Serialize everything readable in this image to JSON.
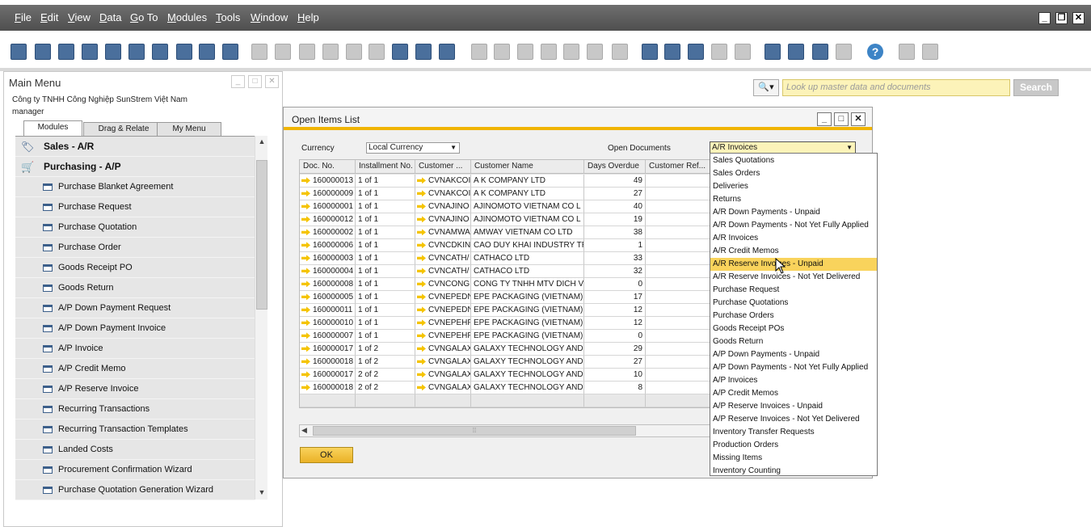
{
  "menubar": {
    "items": [
      "File",
      "Edit",
      "View",
      "Data",
      "Go To",
      "Modules",
      "Tools",
      "Window",
      "Help"
    ],
    "underline": [
      "F",
      "E",
      "V",
      "D",
      "G",
      "M",
      "T",
      "W",
      "H"
    ],
    "window_controls": [
      "_",
      "❐",
      "✕"
    ]
  },
  "toolbar": {
    "icons": [
      "print-preview-icon",
      "print-icon",
      "email-icon",
      "sms-icon",
      "fax-icon",
      "excel-icon",
      "word-icon",
      "pdf-icon",
      "move-icon",
      "lock-icon",
      "find-icon",
      "add-icon",
      "first-record-icon",
      "previous-record-icon",
      "next-record-icon",
      "last-record-icon",
      "refresh-icon",
      "filter-icon",
      "sort-icon",
      "base-document-icon",
      "target-document-icon",
      "gross-profit-icon",
      "payment-means-icon",
      "volume-weight-icon",
      "freight-icon",
      "journal-icon",
      "edit-form-icon",
      "new-document-icon",
      "settings-icon",
      "messages-icon",
      "alerts-icon",
      "activity-icon",
      "inbox-icon",
      "calendar-icon",
      "structure-icon",
      "help-icon",
      "customize-icon",
      "query-icon"
    ]
  },
  "main_menu": {
    "title": "Main Menu",
    "company": "Công ty TNHH Công Nghiệp SunStrem Việt Nam",
    "user": "manager",
    "tabs": [
      "Modules",
      "Drag & Relate",
      "My Menu"
    ],
    "items": [
      {
        "label": "Sales - A/R",
        "type": "module",
        "icon": "sales-icon"
      },
      {
        "label": "Purchasing - A/P",
        "type": "module",
        "icon": "cart-icon"
      },
      {
        "label": "Purchase Blanket Agreement",
        "type": "sub"
      },
      {
        "label": "Purchase Request",
        "type": "sub"
      },
      {
        "label": "Purchase Quotation",
        "type": "sub"
      },
      {
        "label": "Purchase Order",
        "type": "sub"
      },
      {
        "label": "Goods Receipt PO",
        "type": "sub"
      },
      {
        "label": "Goods Return",
        "type": "sub"
      },
      {
        "label": "A/P Down Payment Request",
        "type": "sub"
      },
      {
        "label": "A/P Down Payment Invoice",
        "type": "sub"
      },
      {
        "label": "A/P Invoice",
        "type": "sub"
      },
      {
        "label": "A/P Credit Memo",
        "type": "sub"
      },
      {
        "label": "A/P Reserve Invoice",
        "type": "sub"
      },
      {
        "label": "Recurring Transactions",
        "type": "sub"
      },
      {
        "label": "Recurring Transaction Templates",
        "type": "sub"
      },
      {
        "label": "Landed Costs",
        "type": "sub"
      },
      {
        "label": "Procurement Confirmation Wizard",
        "type": "sub"
      },
      {
        "label": "Purchase Quotation Generation Wizard",
        "type": "sub"
      }
    ]
  },
  "search": {
    "placeholder": "Look up master data and documents",
    "button": "Search"
  },
  "dialog": {
    "title": "Open Items List",
    "currency_label": "Currency",
    "currency_value": "Local Currency",
    "open_docs_label": "Open Documents",
    "open_docs_value": "A/R Invoices",
    "ok_label": "OK",
    "columns": [
      "Doc. No.",
      "Installment No.",
      "Customer ...",
      "Customer Name",
      "Days Overdue",
      "Customer Ref..."
    ],
    "rows": [
      {
        "doc": "160000013",
        "inst": "1 of 1",
        "code": "CVNAKCOI",
        "name": "A K  COMPANY LTD",
        "days": "49"
      },
      {
        "doc": "160000009",
        "inst": "1 of 1",
        "code": "CVNAKCOI",
        "name": "A K  COMPANY LTD",
        "days": "27"
      },
      {
        "doc": "160000001",
        "inst": "1 of 1",
        "code": "CVNAJINO",
        "name": "AJINOMOTO VIETNAM CO   L",
        "days": "40"
      },
      {
        "doc": "160000012",
        "inst": "1 of 1",
        "code": "CVNAJINO",
        "name": "AJINOMOTO VIETNAM CO   L",
        "days": "19"
      },
      {
        "doc": "160000002",
        "inst": "1 of 1",
        "code": "CVNAMWA",
        "name": "AMWAY VIETNAM CO  LTD",
        "days": "38"
      },
      {
        "doc": "160000006",
        "inst": "1 of 1",
        "code": "CVNCDKIN",
        "name": "CAO DUY KHAI INDUSTRY TR",
        "days": "1"
      },
      {
        "doc": "160000003",
        "inst": "1 of 1",
        "code": "CVNCATH/",
        "name": "CATHACO  LTD",
        "days": "33"
      },
      {
        "doc": "160000004",
        "inst": "1 of 1",
        "code": "CVNCATH/",
        "name": "CATHACO  LTD",
        "days": "32"
      },
      {
        "doc": "160000008",
        "inst": "1 of 1",
        "code": "CVNCONG",
        "name": "CONG TY TNHH MTV DICH V",
        "days": "0"
      },
      {
        "doc": "160000005",
        "inst": "1 of 1",
        "code": "CVNEPEDN",
        "name": "EPE PACKAGING (VIETNAM)",
        "days": "17"
      },
      {
        "doc": "160000011",
        "inst": "1 of 1",
        "code": "CVNEPEDN",
        "name": "EPE PACKAGING (VIETNAM)",
        "days": "12"
      },
      {
        "doc": "160000010",
        "inst": "1 of 1",
        "code": "CVNEPEHF",
        "name": "EPE PACKAGING (VIETNAM)",
        "days": "12"
      },
      {
        "doc": "160000007",
        "inst": "1 of 1",
        "code": "CVNEPEHF",
        "name": "EPE PACKAGING (VIETNAM)",
        "days": "0"
      },
      {
        "doc": "160000017",
        "inst": "1 of 2",
        "code": "CVNGALAX",
        "name": "GALAXY TECHNOLOGY AND T",
        "days": "29"
      },
      {
        "doc": "160000018",
        "inst": "1 of 2",
        "code": "CVNGALAX",
        "name": "GALAXY TECHNOLOGY AND T",
        "days": "27"
      },
      {
        "doc": "160000017",
        "inst": "2 of 2",
        "code": "CVNGALAX",
        "name": "GALAXY TECHNOLOGY AND T",
        "days": "10"
      },
      {
        "doc": "160000018",
        "inst": "2 of 2",
        "code": "CVNGALAX",
        "name": "GALAXY TECHNOLOGY AND T",
        "days": "8"
      }
    ]
  },
  "dropdown": {
    "highlighted_index": 8,
    "options": [
      "Sales Quotations",
      "Sales Orders",
      "Deliveries",
      "Returns",
      "A/R Down Payments - Unpaid",
      "A/R Down Payments - Not Yet Fully Applied",
      "A/R Invoices",
      "A/R Credit Memos",
      "A/R Reserve Invoices - Unpaid",
      "A/R Reserve Invoices - Not Yet Delivered",
      "Purchase Request",
      "Purchase Quotations",
      "Purchase Orders",
      "Goods Receipt POs",
      "Goods Return",
      "A/P Down Payments - Unpaid",
      "A/P Down Payments - Not Yet Fully Applied",
      "A/P Invoices",
      "A/P Credit Memos",
      "A/P Reserve Invoices - Unpaid",
      "A/P Reserve Invoices - Not Yet Delivered",
      "Inventory Transfer Requests",
      "Production Orders",
      "Missing Items",
      "Inventory Counting"
    ]
  },
  "colors": {
    "accent": "#f0b400",
    "highlight": "#f9d35c",
    "search_field": "#fcf3b9",
    "menubar": "#5a5a5a"
  }
}
